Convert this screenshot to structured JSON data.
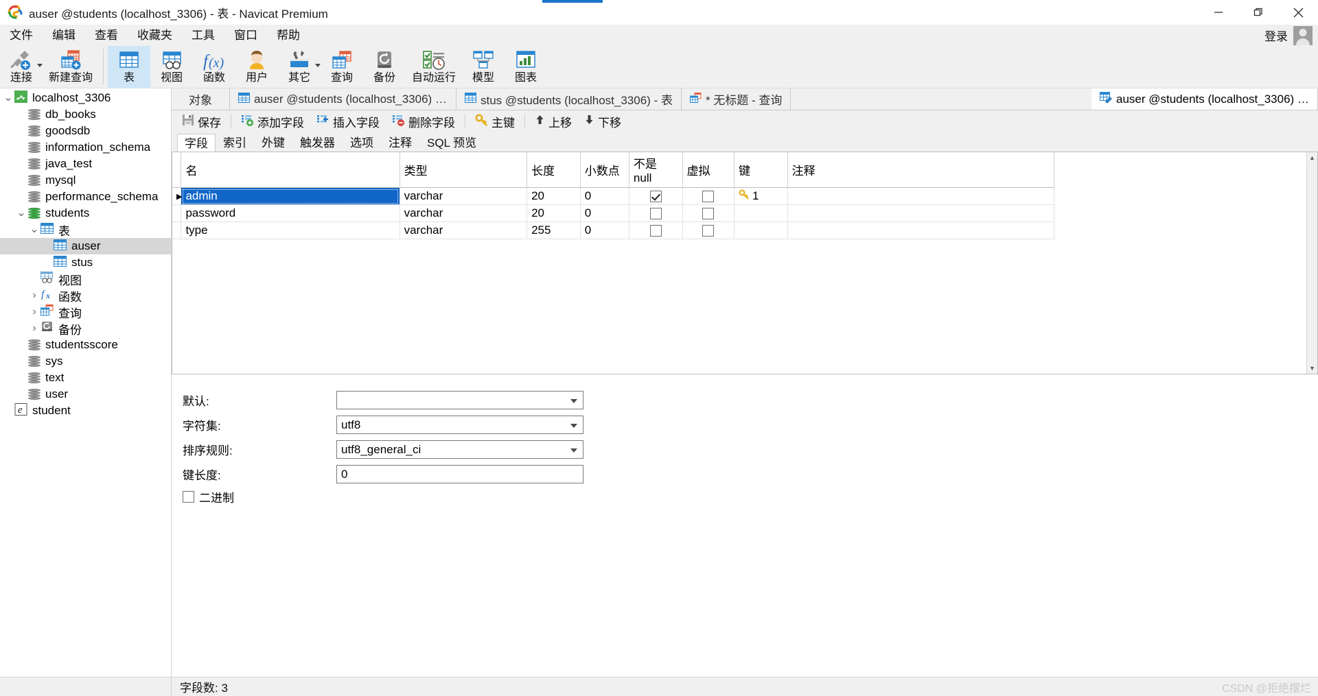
{
  "window": {
    "title": "auser @students (localhost_3306) - 表 - Navicat Premium",
    "minimize": "minimize-icon",
    "restore": "restore-icon",
    "close": "close-icon"
  },
  "menubar": {
    "items": [
      "文件",
      "编辑",
      "查看",
      "收藏夹",
      "工具",
      "窗口",
      "帮助"
    ],
    "login_label": "登录"
  },
  "ribbon": {
    "items": [
      {
        "label": "连接",
        "icon": "connection-icon",
        "caret": true,
        "selected": false
      },
      {
        "label": "新建查询",
        "icon": "new-query-icon",
        "caret": false,
        "selected": false
      },
      {
        "label": "表",
        "icon": "table-icon",
        "caret": false,
        "selected": true
      },
      {
        "label": "视图",
        "icon": "view-icon",
        "caret": false,
        "selected": false
      },
      {
        "label": "函数",
        "icon": "function-icon",
        "caret": false,
        "selected": false
      },
      {
        "label": "用户",
        "icon": "user-icon",
        "caret": false,
        "selected": false
      },
      {
        "label": "其它",
        "icon": "others-icon",
        "caret": true,
        "selected": false
      },
      {
        "label": "查询",
        "icon": "query-icon",
        "caret": false,
        "selected": false
      },
      {
        "label": "备份",
        "icon": "backup-icon",
        "caret": false,
        "selected": false
      },
      {
        "label": "自动运行",
        "icon": "automation-icon",
        "caret": false,
        "selected": false
      },
      {
        "label": "模型",
        "icon": "model-icon",
        "caret": false,
        "selected": false
      },
      {
        "label": "图表",
        "icon": "chart-icon",
        "caret": false,
        "selected": false
      }
    ]
  },
  "sidebar": {
    "tree": [
      {
        "label": "localhost_3306",
        "indent": 0,
        "arrow": "down",
        "icon": "mysql-server-icon",
        "selected": false
      },
      {
        "label": "db_books",
        "indent": 1,
        "arrow": "none",
        "icon": "database-icon",
        "selected": false
      },
      {
        "label": "goodsdb",
        "indent": 1,
        "arrow": "none",
        "icon": "database-icon",
        "selected": false
      },
      {
        "label": "information_schema",
        "indent": 1,
        "arrow": "none",
        "icon": "database-icon",
        "selected": false
      },
      {
        "label": "java_test",
        "indent": 1,
        "arrow": "none",
        "icon": "database-icon",
        "selected": false
      },
      {
        "label": "mysql",
        "indent": 1,
        "arrow": "none",
        "icon": "database-icon",
        "selected": false
      },
      {
        "label": "performance_schema",
        "indent": 1,
        "arrow": "none",
        "icon": "database-icon",
        "selected": false
      },
      {
        "label": "students",
        "indent": 1,
        "arrow": "down",
        "icon": "database-open-icon",
        "selected": false
      },
      {
        "label": "表",
        "indent": 2,
        "arrow": "down",
        "icon": "table-folder-icon",
        "selected": false
      },
      {
        "label": "auser",
        "indent": 3,
        "arrow": "none",
        "icon": "table-icon",
        "selected": true
      },
      {
        "label": "stus",
        "indent": 3,
        "arrow": "none",
        "icon": "table-icon",
        "selected": false
      },
      {
        "label": "视图",
        "indent": 2,
        "arrow": "none",
        "icon": "view-folder-icon",
        "selected": false
      },
      {
        "label": "函数",
        "indent": 2,
        "arrow": "right",
        "icon": "function-folder-icon",
        "selected": false
      },
      {
        "label": "查询",
        "indent": 2,
        "arrow": "right",
        "icon": "query-folder-icon",
        "selected": false
      },
      {
        "label": "备份",
        "indent": 2,
        "arrow": "right",
        "icon": "backup-folder-icon",
        "selected": false
      },
      {
        "label": "studentsscore",
        "indent": 1,
        "arrow": "none",
        "icon": "database-icon",
        "selected": false
      },
      {
        "label": "sys",
        "indent": 1,
        "arrow": "none",
        "icon": "database-icon",
        "selected": false
      },
      {
        "label": "text",
        "indent": 1,
        "arrow": "none",
        "icon": "database-icon",
        "selected": false
      },
      {
        "label": "user",
        "indent": 1,
        "arrow": "none",
        "icon": "database-icon",
        "selected": false
      },
      {
        "label": "student",
        "indent": 0,
        "arrow": "none",
        "icon": "model-file-icon",
        "selected": false
      }
    ]
  },
  "tabstrip": {
    "object_button": "对象",
    "tabs": [
      {
        "label": "auser @students (localhost_3306) - ...",
        "icon": "table-icon",
        "active": false
      },
      {
        "label": "stus @students (localhost_3306) - 表",
        "icon": "table-icon",
        "active": false
      },
      {
        "label": "* 无标题 - 查询",
        "icon": "query-icon",
        "active": false
      },
      {
        "label": "auser @students (localhost_3306) - ...",
        "icon": "table-design-icon",
        "active": true
      }
    ]
  },
  "design_toolbar": {
    "buttons": [
      {
        "label": "保存",
        "icon": "save-icon"
      },
      {
        "label": "添加字段",
        "icon": "add-field-icon"
      },
      {
        "label": "插入字段",
        "icon": "insert-field-icon"
      },
      {
        "label": "删除字段",
        "icon": "delete-field-icon"
      },
      {
        "label": "主键",
        "icon": "primary-key-icon"
      },
      {
        "label": "上移",
        "icon": "move-up-icon"
      },
      {
        "label": "下移",
        "icon": "move-down-icon"
      }
    ]
  },
  "subtabs": {
    "items": [
      "字段",
      "索引",
      "外键",
      "触发器",
      "选项",
      "注释",
      "SQL 预览"
    ],
    "active": "字段"
  },
  "grid": {
    "columns": [
      "名",
      "类型",
      "长度",
      "小数点",
      "不是 null",
      "虚拟",
      "键",
      "注释"
    ],
    "rows": [
      {
        "marker": "▶",
        "name": "admin",
        "type": "varchar",
        "length": "20",
        "decimals": "0",
        "not_null": true,
        "virtual": false,
        "key": "1",
        "comment": "",
        "selected": true
      },
      {
        "marker": "",
        "name": "password",
        "type": "varchar",
        "length": "20",
        "decimals": "0",
        "not_null": false,
        "virtual": false,
        "key": "",
        "comment": "",
        "selected": false
      },
      {
        "marker": "",
        "name": "type",
        "type": "varchar",
        "length": "255",
        "decimals": "0",
        "not_null": false,
        "virtual": false,
        "key": "",
        "comment": "",
        "selected": false
      }
    ]
  },
  "properties": {
    "fields": [
      {
        "label": "默认:",
        "value": "",
        "kind": "select"
      },
      {
        "label": "字符集:",
        "value": "utf8",
        "kind": "select"
      },
      {
        "label": "排序规则:",
        "value": "utf8_general_ci",
        "kind": "select"
      },
      {
        "label": "键长度:",
        "value": "0",
        "kind": "text"
      }
    ],
    "checkbox_label": "二进制",
    "checkbox_checked": false
  },
  "statusbar": {
    "text": "字段数: 3",
    "watermark": "CSDN @拒绝摆烂"
  },
  "colors": {
    "accent": "#1266c8",
    "ribbon_selected": "#cfe6f7",
    "chrome": "#f0f0f0",
    "tree_selected": "#d6d6d6"
  }
}
